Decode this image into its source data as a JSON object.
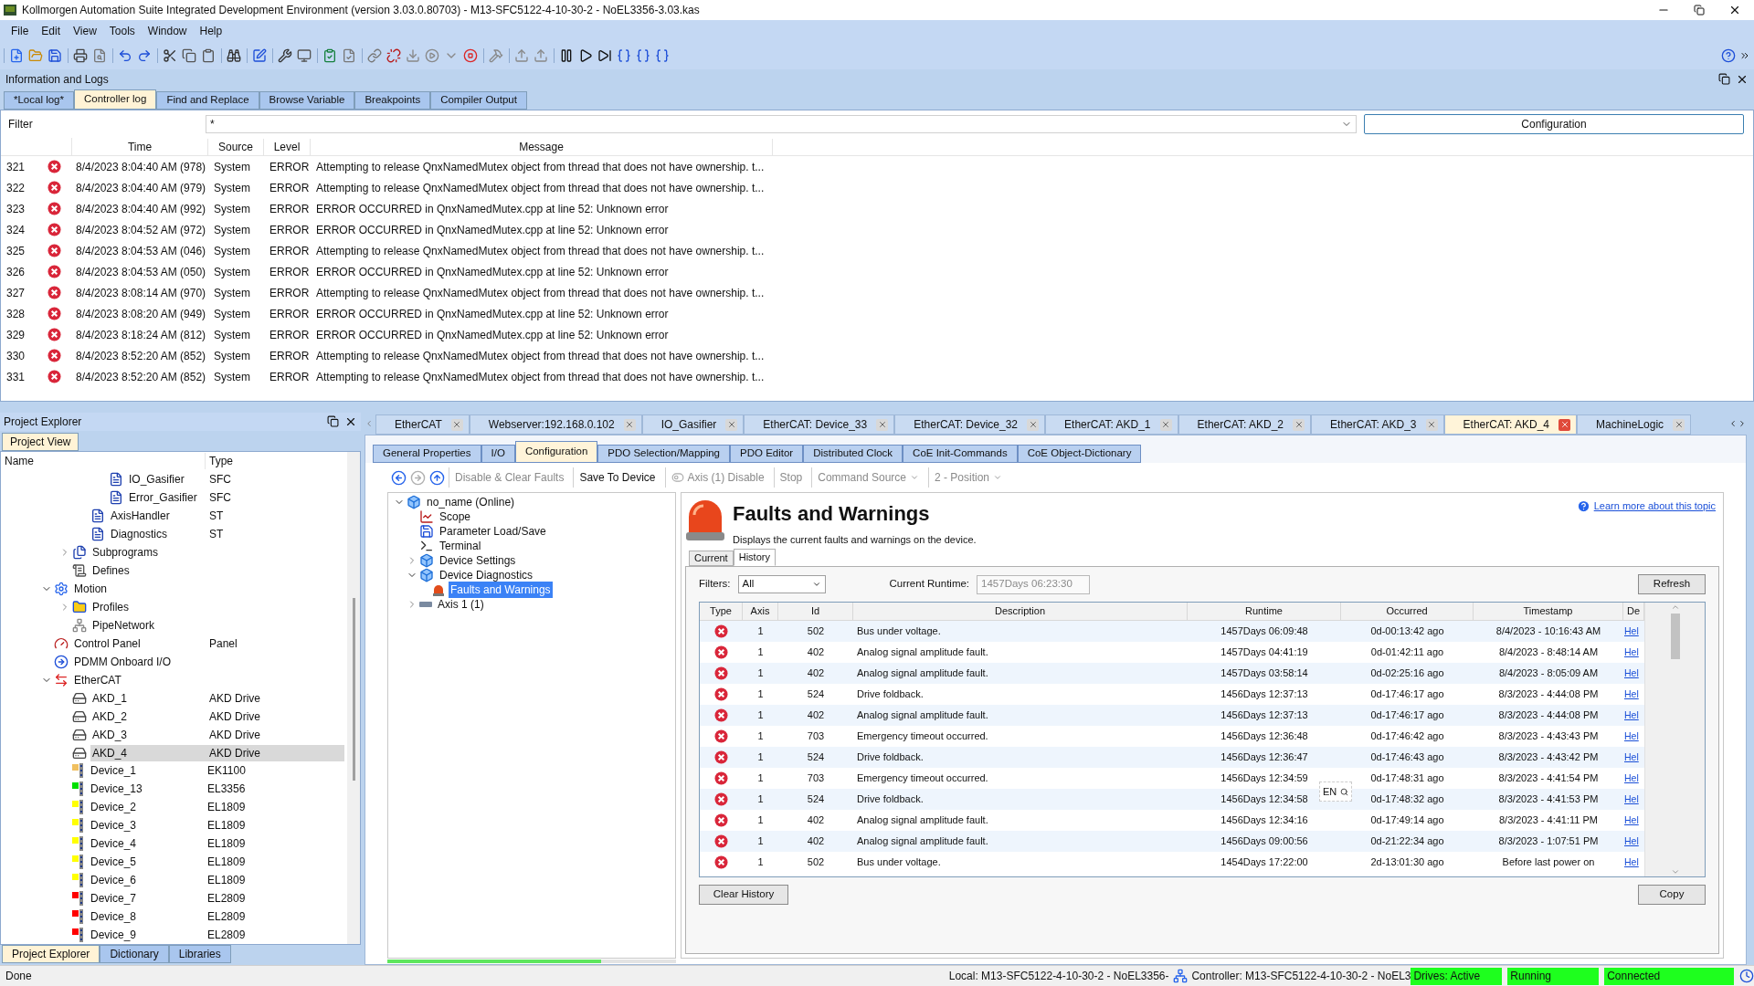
{
  "window": {
    "title": "Kollmorgen Automation Suite Integrated Development Environment (version 3.03.0.80703) - M13-SFC5122-4-10-30-2 - NoEL3356-3.03.kas"
  },
  "menu": [
    "File",
    "Edit",
    "View",
    "Tools",
    "Window",
    "Help"
  ],
  "info_panel": {
    "title": "Information and Logs",
    "tabs": [
      {
        "label": "*Local log*",
        "selected": false
      },
      {
        "label": "Controller log",
        "selected": true
      },
      {
        "label": "Find and Replace",
        "selected": false
      },
      {
        "label": "Browse Variable",
        "selected": false
      },
      {
        "label": "Breakpoints",
        "selected": false
      },
      {
        "label": "Compiler Output",
        "selected": false
      }
    ],
    "filter": {
      "label": "Filter",
      "value": "*"
    },
    "configuration_button": "Configuration",
    "columns": [
      "Time",
      "Source",
      "Level",
      "Message"
    ],
    "rows": [
      {
        "num": "321",
        "time": "8/4/2023 8:04:40 AM (978)",
        "source": "System",
        "level": "ERROR",
        "message": "Attempting to release QnxNamedMutex object from thread that does not have ownership. t..."
      },
      {
        "num": "322",
        "time": "8/4/2023 8:04:40 AM (979)",
        "source": "System",
        "level": "ERROR",
        "message": "Attempting to release QnxNamedMutex object from thread that does not have ownership. t..."
      },
      {
        "num": "323",
        "time": "8/4/2023 8:04:40 AM (992)",
        "source": "System",
        "level": "ERROR",
        "message": "ERROR OCCURRED in QnxNamedMutex.cpp at line 52: Unknown error"
      },
      {
        "num": "324",
        "time": "8/4/2023 8:04:52 AM (972)",
        "source": "System",
        "level": "ERROR",
        "message": "ERROR OCCURRED in QnxNamedMutex.cpp at line 52: Unknown error"
      },
      {
        "num": "325",
        "time": "8/4/2023 8:04:53 AM (046)",
        "source": "System",
        "level": "ERROR",
        "message": "Attempting to release QnxNamedMutex object from thread that does not have ownership. t..."
      },
      {
        "num": "326",
        "time": "8/4/2023 8:04:53 AM (050)",
        "source": "System",
        "level": "ERROR",
        "message": "ERROR OCCURRED in QnxNamedMutex.cpp at line 52: Unknown error"
      },
      {
        "num": "327",
        "time": "8/4/2023 8:08:14 AM (970)",
        "source": "System",
        "level": "ERROR",
        "message": "Attempting to release QnxNamedMutex object from thread that does not have ownership. t..."
      },
      {
        "num": "328",
        "time": "8/4/2023 8:08:20 AM (949)",
        "source": "System",
        "level": "ERROR",
        "message": "ERROR OCCURRED in QnxNamedMutex.cpp at line 52: Unknown error"
      },
      {
        "num": "329",
        "time": "8/4/2023 8:18:24 AM (812)",
        "source": "System",
        "level": "ERROR",
        "message": "ERROR OCCURRED in QnxNamedMutex.cpp at line 52: Unknown error"
      },
      {
        "num": "330",
        "time": "8/4/2023 8:52:20 AM (852)",
        "source": "System",
        "level": "ERROR",
        "message": "Attempting to release QnxNamedMutex object from thread that does not have ownership. t..."
      },
      {
        "num": "331",
        "time": "8/4/2023 8:52:20 AM (852)",
        "source": "System",
        "level": "ERROR",
        "message": "Attempting to release QnxNamedMutex object from thread that does not have ownership. t..."
      }
    ]
  },
  "project_explorer": {
    "title": "Project Explorer",
    "tabs": [
      {
        "label": "Project View",
        "selected": true
      }
    ],
    "columns": [
      "Name",
      "Type"
    ],
    "tree": [
      {
        "children": [
          {
            "children": [
              {
                "children": [
                  {
                    "label": "IO_Gasifier",
                    "type": "SFC",
                    "kind": "program",
                    "selected": false
                  },
                  {
                    "label": "Error_Gasifier",
                    "type": "SFC",
                    "kind": "program",
                    "selected": false
                  }
                ]
              },
              {
                "label": "AxisHandler",
                "type": "ST",
                "kind": "program",
                "selected": false
              },
              {
                "label": "Diagnostics",
                "type": "ST",
                "kind": "program",
                "selected": false
              }
            ]
          },
          {
            "label": "Subprograms",
            "kind": "subprograms",
            "expanded": false,
            "selected": false
          },
          {
            "label": "Defines",
            "kind": "defines",
            "selected": false
          }
        ]
      },
      {
        "label": "Motion",
        "kind": "motion",
        "expanded": true,
        "selected": false,
        "children": [
          {
            "label": "Profiles",
            "kind": "profiles",
            "expanded": false,
            "selected": false
          },
          {
            "label": "PipeNetwork",
            "kind": "pipe",
            "selected": false
          }
        ]
      },
      {
        "label": "Control Panel",
        "type": "Panel",
        "kind": "panel",
        "selected": false
      },
      {
        "label": "PDMM Onboard I/O",
        "kind": "io",
        "selected": false
      },
      {
        "label": "EtherCAT",
        "kind": "ethercat",
        "expanded": true,
        "selected": false,
        "children": [
          {
            "label": "AKD_1",
            "type": "AKD Drive",
            "kind": "drive",
            "selected": false
          },
          {
            "label": "AKD_2",
            "type": "AKD Drive",
            "kind": "drive",
            "selected": false
          },
          {
            "label": "AKD_3",
            "type": "AKD Drive",
            "kind": "drive",
            "selected": false
          },
          {
            "label": "AKD_4",
            "type": "AKD Drive",
            "kind": "drive",
            "selected": true
          },
          {
            "label": "Device_1",
            "type": "EK1100",
            "kind": "device",
            "color": "#f0c060",
            "selected": false
          },
          {
            "label": "Device_13",
            "type": "EL3356",
            "kind": "device",
            "color": "#00e000",
            "selected": false
          },
          {
            "label": "Device_2",
            "type": "EL1809",
            "kind": "device",
            "color": "#ffff00",
            "selected": false
          },
          {
            "label": "Device_3",
            "type": "EL1809",
            "kind": "device",
            "color": "#ffff00",
            "selected": false
          },
          {
            "label": "Device_4",
            "type": "EL1809",
            "kind": "device",
            "color": "#ffff00",
            "selected": false
          },
          {
            "label": "Device_5",
            "type": "EL1809",
            "kind": "device",
            "color": "#ffff00",
            "selected": false
          },
          {
            "label": "Device_6",
            "type": "EL1809",
            "kind": "device",
            "color": "#ffff00",
            "selected": false
          },
          {
            "label": "Device_7",
            "type": "EL2809",
            "kind": "device",
            "color": "#ff0000",
            "selected": false
          },
          {
            "label": "Device_8",
            "type": "EL2809",
            "kind": "device",
            "color": "#ff0000",
            "selected": false
          },
          {
            "label": "Device_9",
            "type": "EL2809",
            "kind": "device",
            "color": "#ff0000",
            "selected": false
          }
        ]
      }
    ],
    "bottom_tabs": [
      {
        "label": "Project Explorer",
        "selected": true
      },
      {
        "label": "Dictionary",
        "selected": false
      },
      {
        "label": "Libraries",
        "selected": false
      }
    ]
  },
  "document_tabs": [
    {
      "label": "EtherCAT",
      "selected": false
    },
    {
      "label": "Webserver:192.168.0.102",
      "selected": false
    },
    {
      "label": "IO_Gasifier",
      "selected": false
    },
    {
      "label": "EtherCAT: Device_33",
      "selected": false
    },
    {
      "label": "EtherCAT: Device_32",
      "selected": false
    },
    {
      "label": "EtherCAT: AKD_1",
      "selected": false
    },
    {
      "label": "EtherCAT: AKD_2",
      "selected": false
    },
    {
      "label": "EtherCAT: AKD_3",
      "selected": false
    },
    {
      "label": "EtherCAT: AKD_4",
      "selected": true
    },
    {
      "label": "MachineLogic",
      "selected": false
    }
  ],
  "device_tabs": [
    {
      "label": "General Properties",
      "selected": false
    },
    {
      "label": "I/O",
      "selected": false
    },
    {
      "label": "Configuration",
      "selected": true
    },
    {
      "label": "PDO Selection/Mapping",
      "selected": false
    },
    {
      "label": "PDO Editor",
      "selected": false
    },
    {
      "label": "Distributed Clock",
      "selected": false
    },
    {
      "label": "CoE Init-Commands",
      "selected": false
    },
    {
      "label": "CoE Object-Dictionary",
      "selected": false
    }
  ],
  "nav_buttons": [
    {
      "kind": "back",
      "disabled": false
    },
    {
      "kind": "forward",
      "disabled": true
    },
    {
      "kind": "up",
      "disabled": false
    }
  ],
  "device_toolbar": [
    {
      "kind": "button",
      "label": "Disable & Clear Faults",
      "disabled": true
    },
    {
      "kind": "button",
      "label": "Save To Device",
      "disabled": false
    },
    {
      "kind": "toggle",
      "label": "Axis (1) Disable",
      "disabled": true
    },
    {
      "kind": "button",
      "label": "Stop",
      "disabled": true
    },
    {
      "kind": "dropdown",
      "label": "Command Source",
      "disabled": true
    },
    {
      "kind": "dropdown",
      "label": "2 - Position",
      "disabled": true
    }
  ],
  "device_tree": [
    {
      "label": "no_name (Online)",
      "kind": "device",
      "expanded": true,
      "selected": false,
      "children": [
        {
          "label": "Scope",
          "kind": "scope",
          "selected": false
        },
        {
          "label": "Parameter Load/Save",
          "kind": "save",
          "selected": false
        },
        {
          "label": "Terminal",
          "kind": "terminal",
          "selected": false
        },
        {
          "label": "Device Settings",
          "kind": "device",
          "expanded": false,
          "selected": false
        },
        {
          "label": "Device Diagnostics",
          "kind": "device",
          "expanded": true,
          "selected": false,
          "children": [
            {
              "label": "Faults and Warnings",
              "kind": "faults",
              "selected": true
            }
          ]
        },
        {
          "label": "Axis 1 (1)",
          "kind": "axis",
          "expanded": false,
          "selected": false
        }
      ]
    }
  ],
  "faults": {
    "title": "Faults and Warnings",
    "subtitle": "Displays the current faults and warnings on the device.",
    "help_link": "Learn more about this topic",
    "tabs": [
      {
        "label": "Current",
        "selected": false
      },
      {
        "label": "History",
        "selected": true
      }
    ],
    "filters_label": "Filters:",
    "filter_value": "All",
    "runtime_label": "Current Runtime:",
    "runtime_value": "1457Days 06:23:30",
    "refresh_button": "Refresh",
    "columns": [
      "Type",
      "Axis",
      "Id",
      "Description",
      "Runtime",
      "Occurred",
      "Timestamp",
      "De"
    ],
    "rows": [
      {
        "axis": "1",
        "id": "502",
        "description": "Bus under voltage.",
        "runtime": "1457Days 06:09:48",
        "occurred": "0d-00:13:42 ago",
        "timestamp": "8/4/2023 - 10:16:43 AM",
        "help": "Hel"
      },
      {
        "axis": "1",
        "id": "402",
        "description": "Analog signal amplitude fault.",
        "runtime": "1457Days 04:41:19",
        "occurred": "0d-01:42:11 ago",
        "timestamp": "8/4/2023 - 8:48:14 AM",
        "help": "Hel"
      },
      {
        "axis": "1",
        "id": "402",
        "description": "Analog signal amplitude fault.",
        "runtime": "1457Days 03:58:14",
        "occurred": "0d-02:25:16 ago",
        "timestamp": "8/4/2023 - 8:05:09 AM",
        "help": "Hel"
      },
      {
        "axis": "1",
        "id": "524",
        "description": "Drive foldback.",
        "runtime": "1456Days 12:37:13",
        "occurred": "0d-17:46:17 ago",
        "timestamp": "8/3/2023 - 4:44:08 PM",
        "help": "Hel"
      },
      {
        "axis": "1",
        "id": "402",
        "description": "Analog signal amplitude fault.",
        "runtime": "1456Days 12:37:13",
        "occurred": "0d-17:46:17 ago",
        "timestamp": "8/3/2023 - 4:44:08 PM",
        "help": "Hel"
      },
      {
        "axis": "1",
        "id": "703",
        "description": "Emergency timeout occurred.",
        "runtime": "1456Days 12:36:48",
        "occurred": "0d-17:46:42 ago",
        "timestamp": "8/3/2023 - 4:43:43 PM",
        "help": "Hel"
      },
      {
        "axis": "1",
        "id": "524",
        "description": "Drive foldback.",
        "runtime": "1456Days 12:36:47",
        "occurred": "0d-17:46:43 ago",
        "timestamp": "8/3/2023 - 4:43:42 PM",
        "help": "Hel"
      },
      {
        "axis": "1",
        "id": "703",
        "description": "Emergency timeout occurred.",
        "runtime": "1456Days 12:34:59",
        "occurred": "0d-17:48:31 ago",
        "timestamp": "8/3/2023 - 4:41:54 PM",
        "help": "Hel"
      },
      {
        "axis": "1",
        "id": "524",
        "description": "Drive foldback.",
        "runtime": "1456Days 12:34:58",
        "occurred": "0d-17:48:32 ago",
        "timestamp": "8/3/2023 - 4:41:53 PM",
        "help": "Hel"
      },
      {
        "axis": "1",
        "id": "402",
        "description": "Analog signal amplitude fault.",
        "runtime": "1456Days 12:34:16",
        "occurred": "0d-17:49:14 ago",
        "timestamp": "8/3/2023 - 4:41:11 PM",
        "help": "Hel"
      },
      {
        "axis": "1",
        "id": "402",
        "description": "Analog signal amplitude fault.",
        "runtime": "1456Days 09:00:56",
        "occurred": "0d-21:22:34 ago",
        "timestamp": "8/3/2023 - 1:07:51 PM",
        "help": "Hel"
      },
      {
        "axis": "1",
        "id": "502",
        "description": "Bus under voltage.",
        "runtime": "1454Days 17:22:00",
        "occurred": "2d-13:01:30 ago",
        "timestamp": "Before last power on",
        "help": "Hel"
      }
    ],
    "clear_button": "Clear History",
    "copy_button": "Copy",
    "ime_indicator": "EN"
  },
  "progress": {
    "level": 0.74
  },
  "status_bar": {
    "message": "Done",
    "local": "Local: M13-SFC5122-4-10-30-2 - NoEL3356-",
    "controller": "Controller: M13-SFC5122-4-10-30-2 - NoEL3",
    "indicators": [
      "Drives: Active",
      "Running",
      "Connected"
    ]
  }
}
